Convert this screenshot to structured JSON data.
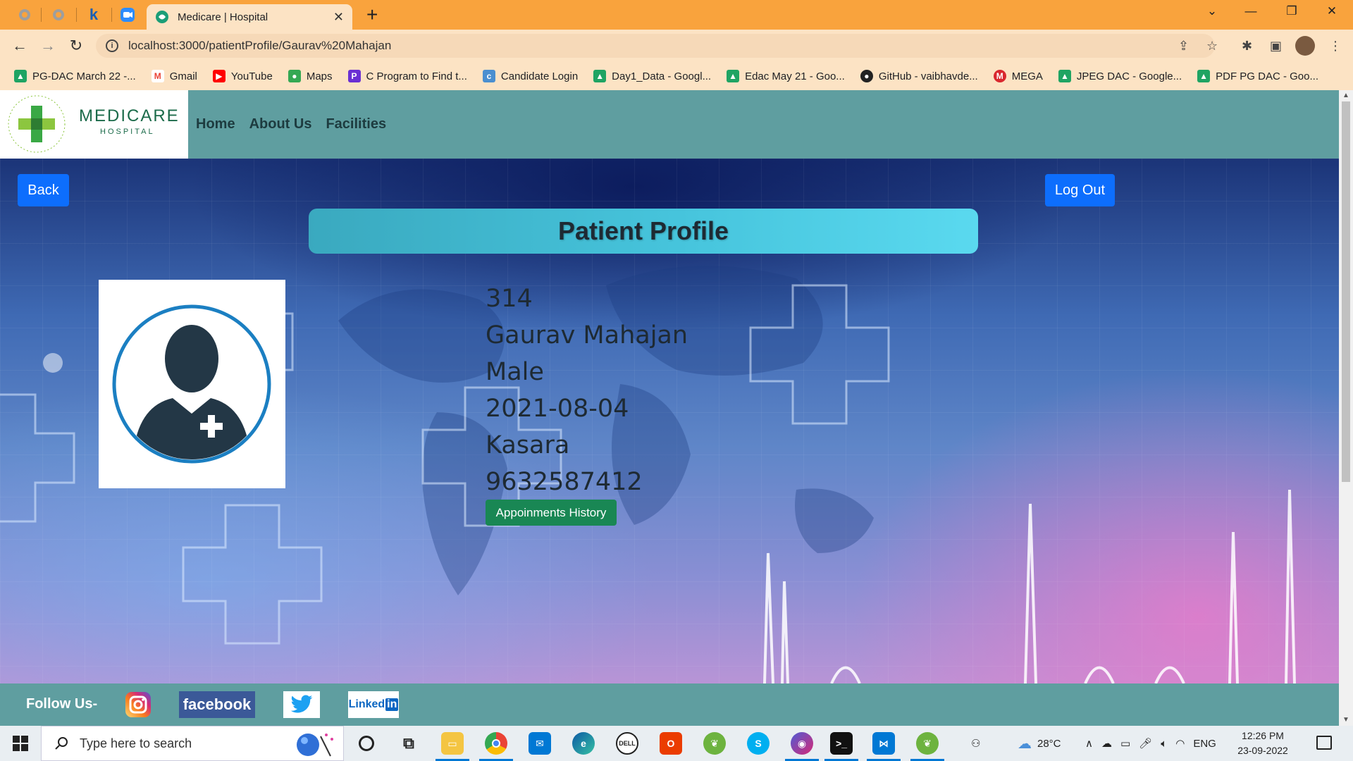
{
  "browser": {
    "tab_title": "Medicare | Hospital",
    "url": "localhost:3000/patientProfile/Gaurav%20Mahajan",
    "bookmarks": [
      {
        "label": "PG-DAC March 22 -...",
        "icon": "google-drive-icon",
        "color": "#1fa463"
      },
      {
        "label": "Gmail",
        "icon": "gmail-icon",
        "color": "#ea4335"
      },
      {
        "label": "YouTube",
        "icon": "youtube-icon",
        "color": "#ff0000"
      },
      {
        "label": "Maps",
        "icon": "maps-icon",
        "color": "#34a853"
      },
      {
        "label": "C Program to Find t...",
        "icon": "programiz-icon",
        "color": "#6a2fd3"
      },
      {
        "label": "Candidate Login",
        "icon": "candidate-icon",
        "color": "#4a8fd0"
      },
      {
        "label": "Day1_Data - Googl...",
        "icon": "google-drive-icon",
        "color": "#1fa463"
      },
      {
        "label": "Edac May 21 - Goo...",
        "icon": "google-drive-icon",
        "color": "#1fa463"
      },
      {
        "label": "GitHub - vaibhavde...",
        "icon": "github-icon",
        "color": "#222222"
      },
      {
        "label": "MEGA",
        "icon": "mega-icon",
        "color": "#d9272e"
      },
      {
        "label": "JPEG DAC - Google...",
        "icon": "google-drive-icon",
        "color": "#1fa463"
      },
      {
        "label": "PDF PG DAC - Goo...",
        "icon": "google-drive-icon",
        "color": "#1fa463"
      }
    ]
  },
  "site": {
    "logo_name": "MEDICARE",
    "logo_sub": "HOSPITAL",
    "logo_ring": "HEALING HANDS CARING HEARTS",
    "nav": [
      "Home",
      "About Us",
      "Facilities"
    ],
    "back_label": "Back",
    "logout_label": "Log Out",
    "heading": "Patient Profile",
    "patient": {
      "id": "314",
      "name": "Gaurav Mahajan",
      "gender": "Male",
      "date": "2021-08-04",
      "city": "Kasara",
      "phone": "9632587412"
    },
    "history_button": "Appoinments History",
    "footer": {
      "follow": "Follow Us-",
      "facebook": "facebook",
      "linkedin": "Linked"
    },
    "colors": {
      "navbar": "#5f9ea0",
      "primary_button": "#0d6efd",
      "success_button": "#198754"
    }
  },
  "taskbar": {
    "search_placeholder": "Type here to search",
    "weather": "28°C",
    "language": "ENG",
    "time": "12:26 PM",
    "date": "23-09-2022"
  }
}
